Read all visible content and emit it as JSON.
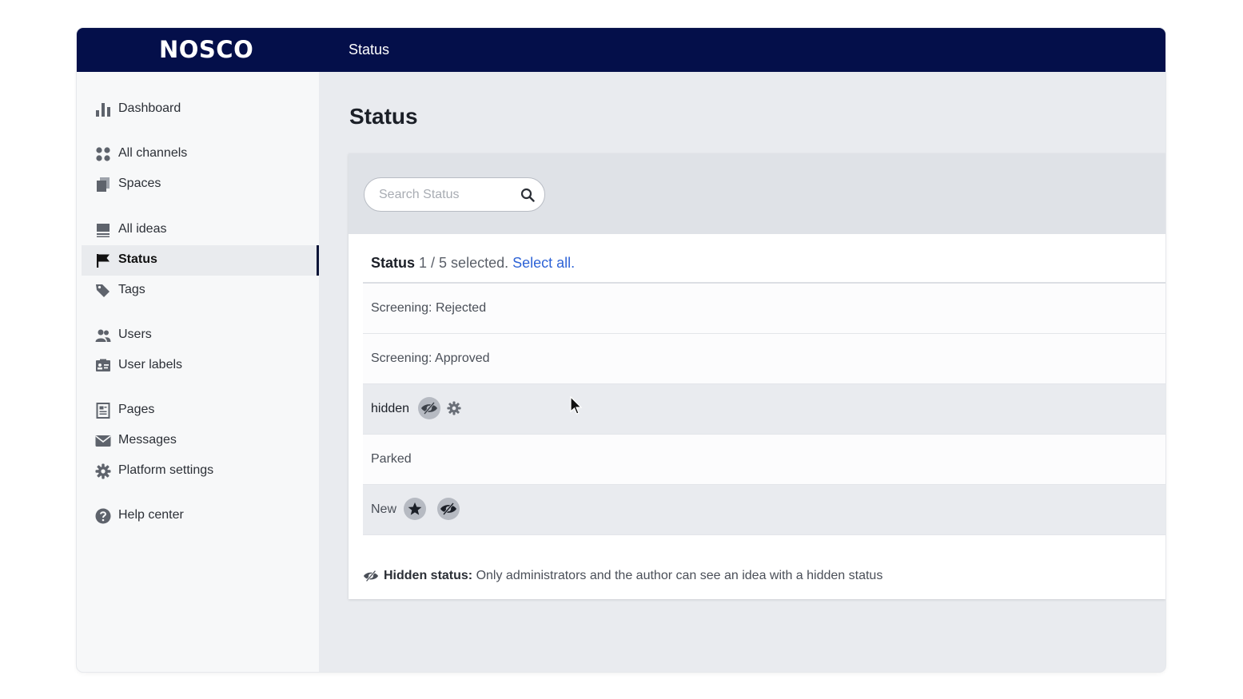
{
  "app": {
    "logo": "NOSCO",
    "section_title": "Status"
  },
  "sidebar": {
    "items": [
      {
        "label": "Dashboard",
        "icon": "bar-chart-icon"
      },
      {
        "label": "All channels",
        "icon": "channels-grid-icon"
      },
      {
        "label": "Spaces",
        "icon": "spaces-icon"
      },
      {
        "label": "All ideas",
        "icon": "ideas-list-icon"
      },
      {
        "label": "Status",
        "icon": "flag-icon",
        "active": true
      },
      {
        "label": "Tags",
        "icon": "tag-icon"
      },
      {
        "label": "Users",
        "icon": "users-icon"
      },
      {
        "label": "User labels",
        "icon": "user-labels-icon"
      },
      {
        "label": "Pages",
        "icon": "pages-icon"
      },
      {
        "label": "Messages",
        "icon": "envelope-icon"
      },
      {
        "label": "Platform settings",
        "icon": "gear-icon"
      },
      {
        "label": "Help center",
        "icon": "help-icon"
      }
    ]
  },
  "main": {
    "page_title": "Status",
    "search": {
      "placeholder": "Search Status",
      "value": ""
    },
    "list_header": {
      "title": "Status",
      "selection": "1 / 5 selected.",
      "select_all": "Select all."
    },
    "rows": [
      {
        "label": "Screening: Rejected"
      },
      {
        "label": "Screening: Approved"
      },
      {
        "label": "hidden",
        "badges": [
          "hidden-eye-icon",
          "gear-icon"
        ]
      },
      {
        "label": "Parked"
      },
      {
        "label": "New",
        "badges": [
          "star-icon",
          "hidden-eye-icon"
        ]
      }
    ],
    "footnote": {
      "bold": "Hidden status:",
      "text": "Only administrators and the author can see an idea with a hidden status"
    }
  },
  "colors": {
    "topbar": "#040f4a",
    "link": "#2e63d6",
    "active_indicator": "#0b1437"
  }
}
